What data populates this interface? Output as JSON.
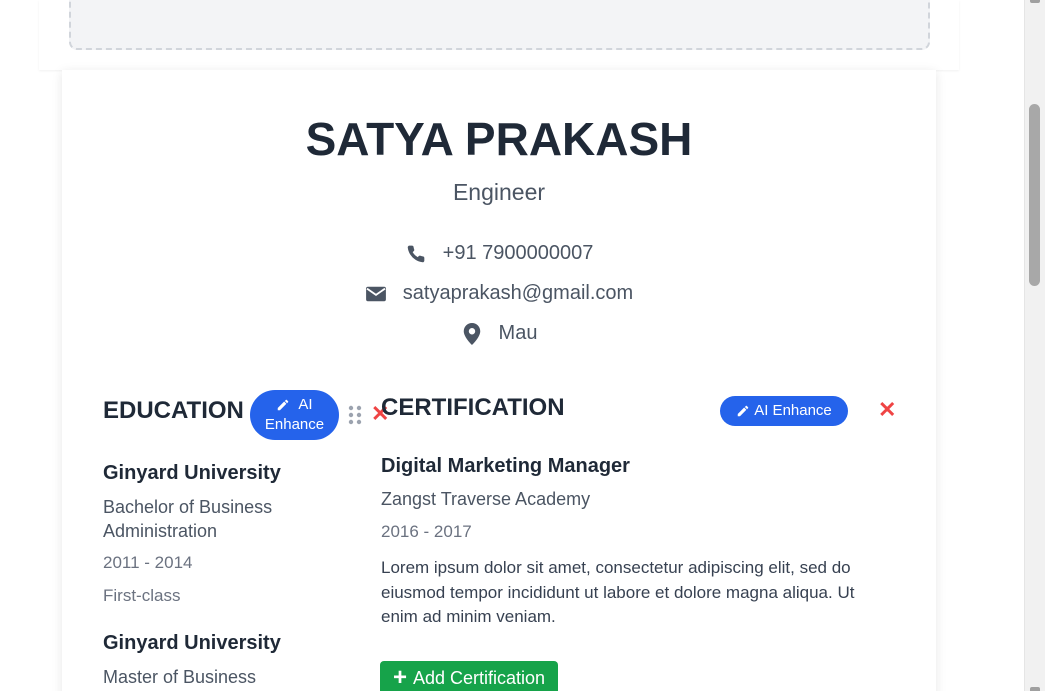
{
  "resume": {
    "name": "SATYA PRAKASH",
    "title": "Engineer",
    "contact": {
      "phone": "+91 7900000007",
      "email": "satyaprakash@gmail.com",
      "location": "Mau"
    }
  },
  "education": {
    "heading": "EDUCATION",
    "ai_enhance_line1": "AI",
    "ai_enhance_line2": "Enhance",
    "items": [
      {
        "school": "Ginyard University",
        "degree": "Bachelor of Business Administration",
        "years": "2011 - 2014",
        "grade": "First-class"
      },
      {
        "school": "Ginyard University",
        "degree": "Master of Business"
      }
    ]
  },
  "certification": {
    "heading": "CERTIFICATION",
    "ai_enhance_label": "AI Enhance",
    "items": [
      {
        "title": "Digital Marketing Manager",
        "organization": "Zangst Traverse Academy",
        "years": "2016 - 2017",
        "description": "Lorem ipsum dolor sit amet, consectetur adipiscing elit, sed do eiusmod tempor incididunt ut labore et dolore magna aliqua. Ut enim ad minim veniam."
      }
    ],
    "add_button_label": "Add Certification"
  },
  "icons": {
    "phone": "phone-icon",
    "email": "envelope-icon",
    "location": "map-pin-icon",
    "edit": "pencil-icon",
    "drag": "drag-handle-icon",
    "remove": "close-icon",
    "add": "plus-icon"
  },
  "colors": {
    "accent_blue": "#2563eb",
    "add_green": "#16a34a",
    "remove_red": "#ef4444",
    "heading": "#1f2937",
    "text": "#4b5563"
  }
}
